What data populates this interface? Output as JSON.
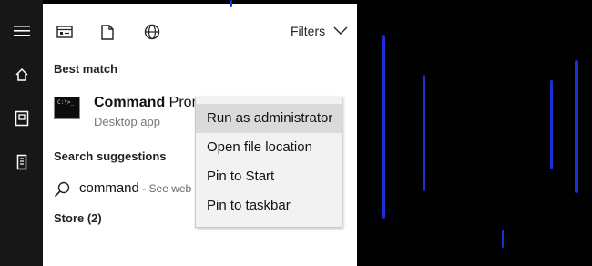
{
  "rail": {
    "items": [
      {
        "icon": "hamburger-menu-icon"
      },
      {
        "icon": "home-icon"
      },
      {
        "icon": "documents-icon"
      },
      {
        "icon": "tower-icon"
      }
    ]
  },
  "toolbar": {
    "filters_label": "Filters",
    "icons": [
      "apps-filter-icon",
      "documents-filter-icon",
      "web-filter-icon"
    ]
  },
  "best_match": {
    "heading": "Best match",
    "app_name_bold": "Command",
    "app_name_rest": " Prompt",
    "app_type": "Desktop app",
    "icon_text": "C:\\>_"
  },
  "suggestions": {
    "heading": "Search suggestions",
    "query": "command",
    "hint": " - See web results"
  },
  "store": {
    "label": "Store (2)"
  },
  "context_menu": {
    "items": [
      {
        "label": "Run as administrator",
        "highlighted": true
      },
      {
        "label": "Open file location",
        "highlighted": false
      },
      {
        "label": "Pin to Start",
        "highlighted": false
      },
      {
        "label": "Pin to taskbar",
        "highlighted": false
      }
    ]
  },
  "colors": {
    "background": "#000000",
    "panel": "#ffffff",
    "rail": "#171717",
    "menu": "#f2f2f2",
    "menu_highlight": "#dadada",
    "wallpaper_streak": "#1b2fd6"
  }
}
